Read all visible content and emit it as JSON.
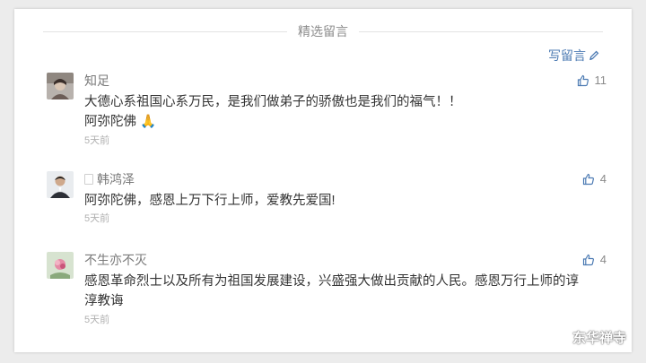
{
  "section": {
    "title": "精选留言"
  },
  "write_comment": {
    "label": "写留言",
    "icon": "pencil-icon"
  },
  "comments": [
    {
      "nickname": "知足",
      "text_lines": [
        "大德心系祖国心系万民，是我们做弟子的骄傲也是我们的福气！！",
        "阿弥陀佛"
      ],
      "emoji": "🙏",
      "time": "5天前",
      "likes": "11"
    },
    {
      "nickname": "韩鸿泽",
      "text_lines": [
        "阿弥陀佛，感恩上万下行上师，爱教先爱国!"
      ],
      "time": "5天前",
      "likes": "4"
    },
    {
      "nickname": "不生亦不灭",
      "text_lines": [
        "感恩革命烈士以及所有为祖国发展建设，兴盛强大做出贡献的人民。感恩万行上师的谆",
        "淳教诲"
      ],
      "time": "5天前",
      "likes": "4"
    }
  ],
  "watermark": {
    "text": "东华禅寺",
    "icon": "wechat-icon"
  },
  "colors": {
    "link": "#4d7bb3",
    "text": "#333333",
    "meta": "#b0b0b0",
    "background": "#ececec"
  }
}
